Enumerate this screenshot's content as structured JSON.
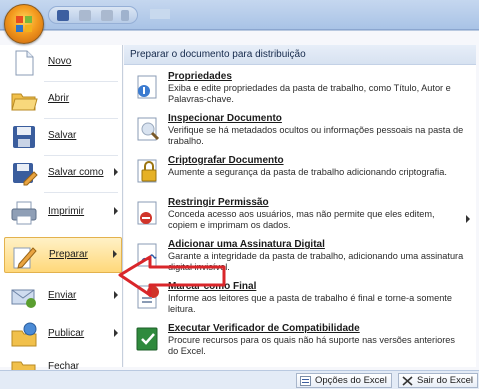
{
  "menu": {
    "left_items": [
      {
        "label": "Novo",
        "icon": "new-document-icon",
        "has_arrow": false
      },
      {
        "label": "Abrir",
        "icon": "open-folder-icon",
        "has_arrow": false
      },
      {
        "label": "Salvar",
        "icon": "save-disk-icon",
        "has_arrow": false
      },
      {
        "label": "Salvar como",
        "icon": "save-as-icon",
        "has_arrow": true
      },
      {
        "label": "Imprimir",
        "icon": "printer-icon",
        "has_arrow": true
      },
      {
        "label": "Preparar",
        "icon": "prepare-pencil-icon",
        "has_arrow": true,
        "selected": true
      },
      {
        "label": "Enviar",
        "icon": "send-icon",
        "has_arrow": true
      },
      {
        "label": "Publicar",
        "icon": "publish-icon",
        "has_arrow": true
      },
      {
        "label": "Fechar",
        "icon": "close-folder-icon",
        "has_arrow": false
      }
    ],
    "right_header": "Preparar o documento para distribuição",
    "entries": [
      {
        "title": "Propriedades",
        "desc": "Exiba e edite propriedades da pasta de trabalho, como Título, Autor e Palavras-chave.",
        "icon": "properties-icon"
      },
      {
        "title": "Inspecionar Documento",
        "desc": "Verifique se há metadados ocultos ou informações pessoais na pasta de trabalho.",
        "icon": "inspect-document-icon"
      },
      {
        "title": "Criptografar Documento",
        "desc": "Aumente a segurança da pasta de trabalho adicionando criptografia.",
        "icon": "encrypt-lock-icon"
      },
      {
        "title": "Restringir Permissão",
        "desc": "Conceda acesso aos usuários, mas não permite que eles editem, copiem e imprimam os dados.",
        "icon": "restrict-permission-icon",
        "has_arrow": true
      },
      {
        "title": "Adicionar uma Assinatura Digital",
        "desc": "Garante a integridade da pasta de trabalho, adicionando uma assinatura digital invisível.",
        "icon": "digital-signature-icon"
      },
      {
        "title": "Marcar como Final",
        "desc": "Informe aos leitores que a pasta de trabalho é final e torne-a somente leitura.",
        "icon": "mark-final-icon"
      },
      {
        "title": "Executar Verificador de Compatibilidade",
        "desc": "Procure recursos para os quais não há suporte nas versões anteriores do Excel.",
        "icon": "compatibility-checker-icon"
      }
    ]
  },
  "bottom": {
    "options_label": "Opções do Excel",
    "exit_label": "Sair do Excel"
  },
  "colors": {
    "selected_bg": "#ffd87a",
    "annotation_red": "#d9262a",
    "header_text": "#15294b"
  }
}
